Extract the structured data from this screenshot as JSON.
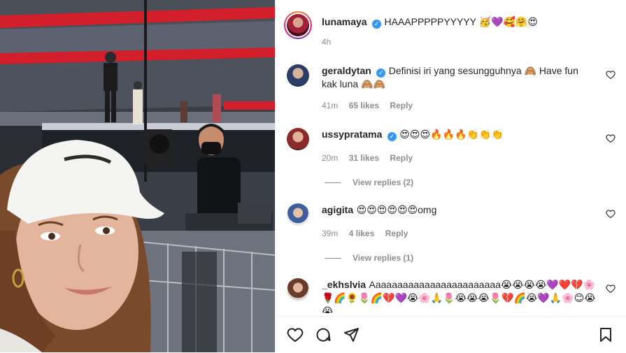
{
  "post": {
    "username": "lunamaya",
    "caption": "HAAAPPPPPYYYYY 🥳💜🥰🤗😍",
    "time": "4h"
  },
  "comments": [
    {
      "username": "geraldytan",
      "verified": true,
      "text": "Definisi iri yang sesungguhnya 🙈 Have fun kak luna 🙈🙈",
      "time": "41m",
      "likes": "65 likes",
      "reply": "Reply"
    },
    {
      "username": "ussypratama",
      "verified": true,
      "text": "😍😍😍🔥🔥🔥👏👏👏",
      "time": "20m",
      "likes": "31 likes",
      "reply": "Reply",
      "view_replies": "View replies (2)"
    },
    {
      "username": "agigita",
      "verified": false,
      "text": "😍😍😍😍😍😍omg",
      "time": "39m",
      "likes": "4 likes",
      "reply": "Reply",
      "view_replies": "View replies (1)"
    },
    {
      "username": "_ekhslvia",
      "verified": false,
      "text": "Aaaaaaaaaaaaaaaaaaaaaaaa😭😭😭😭💜❤️💔🌸🌹🌈🌻🌷🌈💔💜😭🌸🙏🌷😭😭😭🌷💔🌈😭💜🙏🌸😊😭😭"
    }
  ],
  "icons": {
    "verified": "verified-badge-icon",
    "like": "heart-icon",
    "comment": "comment-icon",
    "share": "send-icon",
    "save": "bookmark-icon"
  },
  "colors": {
    "username": "#262626",
    "meta": "#8e8e8e",
    "verified": "#3897f0",
    "stadium_red": "#d21f2b"
  }
}
